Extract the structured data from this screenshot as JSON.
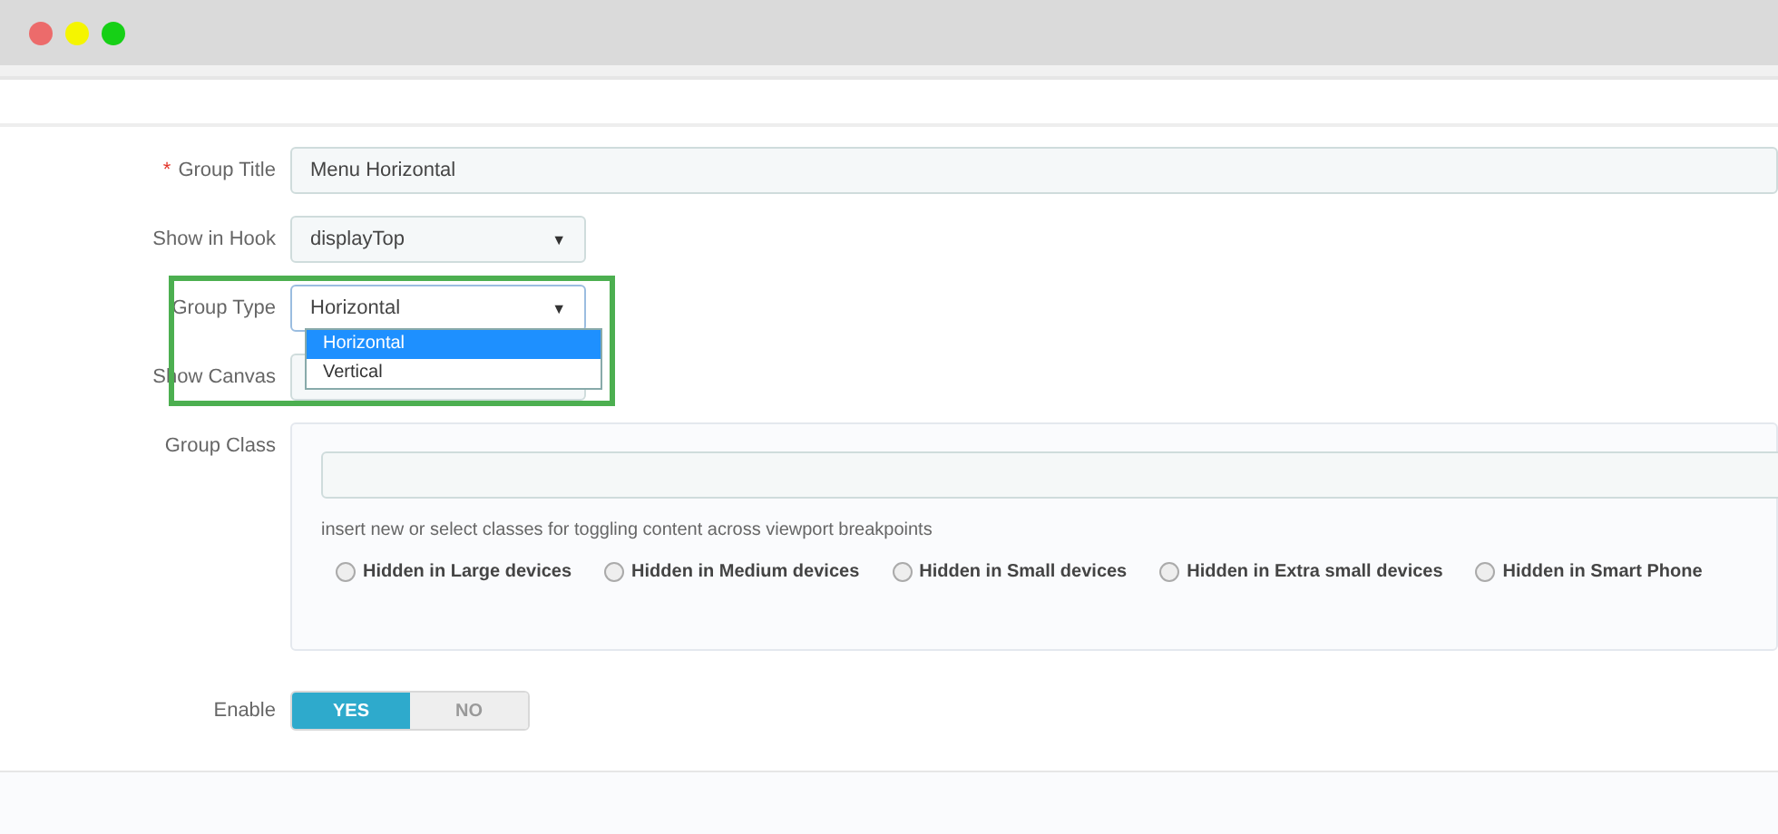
{
  "window": {
    "controls": [
      {
        "color": "#ec6b6b"
      },
      {
        "color": "#f5f500"
      },
      {
        "color": "#16d016"
      }
    ]
  },
  "form": {
    "group_title": {
      "label": "Group Title",
      "required_mark": "*",
      "value": "Menu Horizontal"
    },
    "show_in_hook": {
      "label": "Show in Hook",
      "value": "displayTop",
      "caret": "▼"
    },
    "group_type": {
      "label": "Group Type",
      "value": "Horizontal",
      "caret": "▼",
      "expanded": true,
      "options": [
        {
          "label": "Horizontal",
          "selected": true
        },
        {
          "label": "Vertical",
          "selected": false
        }
      ]
    },
    "show_canvas": {
      "label": "Show Canvas"
    },
    "group_class": {
      "label": "Group Class",
      "help": "insert new or select classes for toggling content across viewport breakpoints",
      "options": [
        {
          "label": "Hidden in Large devices",
          "checked": false
        },
        {
          "label": "Hidden in Medium devices",
          "checked": false
        },
        {
          "label": "Hidden in Small devices",
          "checked": false
        },
        {
          "label": "Hidden in Extra small devices",
          "checked": false
        },
        {
          "label": "Hidden in Smart Phone",
          "checked": false
        }
      ]
    },
    "enable": {
      "label": "Enable",
      "options": [
        {
          "label": "YES",
          "selected": true
        },
        {
          "label": "NO",
          "selected": false
        }
      ]
    }
  }
}
